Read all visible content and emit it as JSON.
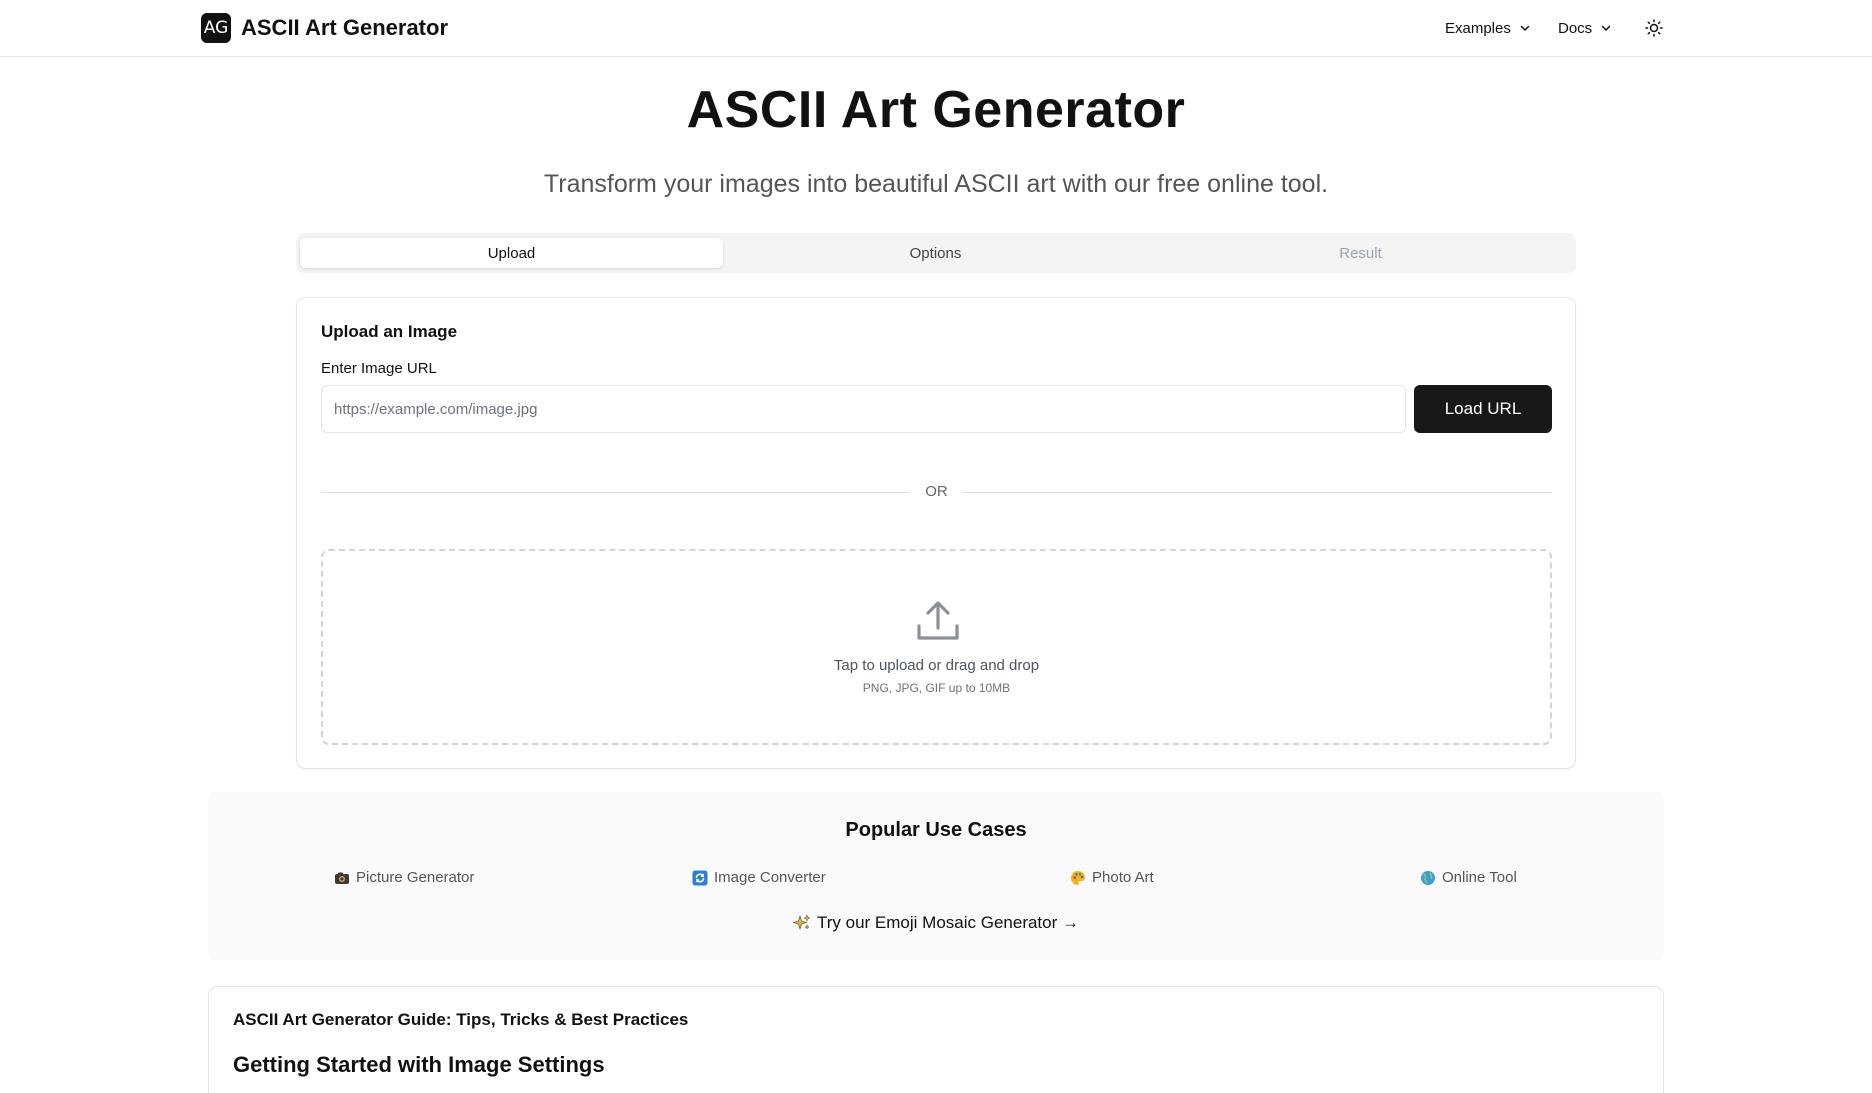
{
  "header": {
    "logo_text": "AG",
    "brand": "ASCII Art Generator",
    "nav": [
      {
        "label": "Examples",
        "icon": "chevron-down-icon"
      },
      {
        "label": "Docs",
        "icon": "chevron-down-icon"
      }
    ],
    "theme_icon": "sun-icon"
  },
  "hero": {
    "title": "ASCII Art Generator",
    "subtitle": "Transform your images into beautiful ASCII art with our free online tool."
  },
  "tabs": [
    {
      "label": "Upload",
      "state": "active"
    },
    {
      "label": "Options",
      "state": "enabled"
    },
    {
      "label": "Result",
      "state": "disabled"
    }
  ],
  "upload_card": {
    "title": "Upload an Image",
    "url_label": "Enter Image URL",
    "url_placeholder": "https://example.com/image.jpg",
    "url_value": "",
    "load_button": "Load URL",
    "divider_text": "OR",
    "dropzone": {
      "icon": "upload-icon",
      "main_text": "Tap to upload or drag and drop",
      "sub_text": "PNG, JPG, GIF up to 10MB"
    }
  },
  "popular": {
    "title": "Popular Use Cases",
    "items": [
      {
        "label": "Picture Generator",
        "icon": "camera-emoji-icon"
      },
      {
        "label": "Image Converter",
        "icon": "refresh-emoji-icon"
      },
      {
        "label": "Photo Art",
        "icon": "palette-emoji-icon"
      },
      {
        "label": "Online Tool",
        "icon": "globe-emoji-icon"
      }
    ],
    "cta": "Try our Emoji Mosaic Generator →",
    "cta_icon": "sparkles-emoji-icon"
  },
  "guide": {
    "title": "ASCII Art Generator Guide: Tips, Tricks & Best Practices",
    "heading": "Getting Started with Image Settings"
  },
  "colors": {
    "primary_button": "#18181b",
    "border": "#e5e5e5",
    "muted_text": "#555555",
    "tab_bg": "#f4f4f5"
  }
}
